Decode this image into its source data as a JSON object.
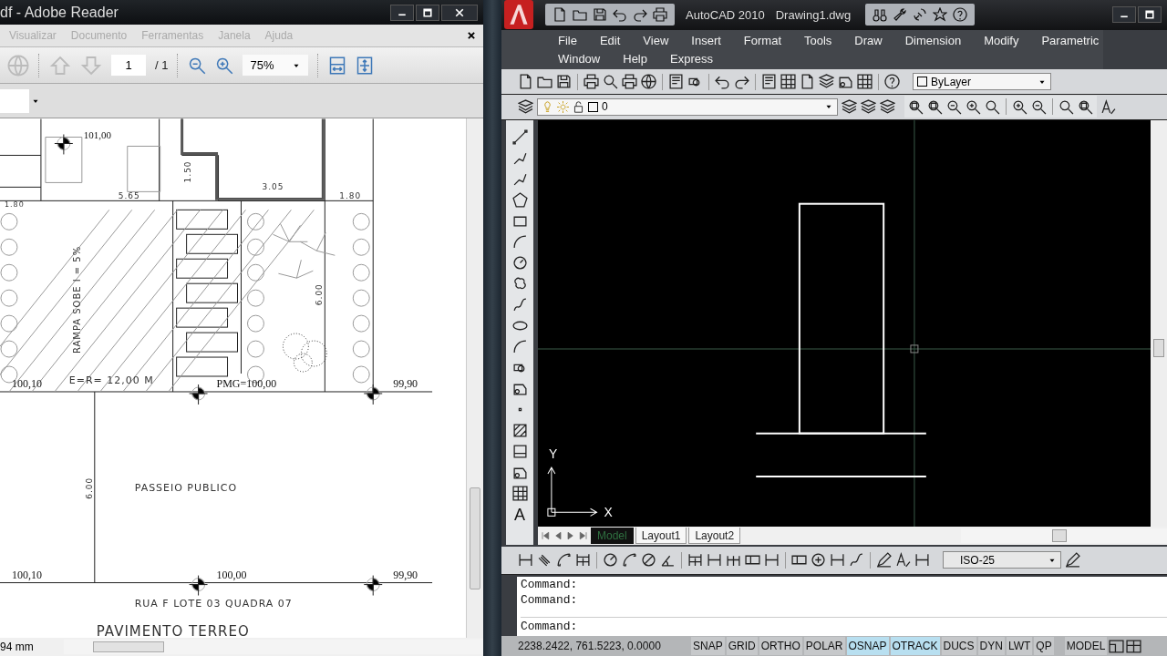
{
  "reader": {
    "title": "df - Adobe Reader",
    "menu": [
      "Visualizar",
      "Documento",
      "Ferramentas",
      "Janela",
      "Ajuda"
    ],
    "page_field": "1",
    "page_total": "/ 1",
    "zoom": "75%",
    "plan_labels": [
      "101,00",
      "1.50",
      "3.05",
      "1.80",
      "5.65",
      "1.80",
      "RAMPA SOBE I = 5%",
      "6.00",
      "100,10",
      "E=R= 12,00 M",
      "PMG=100,00",
      "99,90",
      "6.00",
      "PASSEIO PUBLICO",
      "100,10",
      "100,00",
      "99,90",
      "RUA F   LOTE 03   QUADRA 07",
      "PAVIMENTO TERREO"
    ],
    "page_size": "94 mm"
  },
  "autocad": {
    "app_name": "AutoCAD 2010",
    "file_name": "Drawing1.dwg",
    "menu": [
      "File",
      "Edit",
      "View",
      "Insert",
      "Format",
      "Tools",
      "Draw",
      "Dimension",
      "Modify",
      "Parametric",
      "Window",
      "Help",
      "Express"
    ],
    "color_control": "ByLayer",
    "layer": "0",
    "text_tool": "A",
    "axis_y": "Y",
    "axis_x": "X",
    "layout_tabs": [
      {
        "label": "Model",
        "selected": true
      },
      {
        "label": "Layout1",
        "selected": false
      },
      {
        "label": "Layout2",
        "selected": false
      }
    ],
    "dim_style": "ISO-25",
    "command_lines": [
      "Command:",
      "Command:",
      "Command:"
    ],
    "coordinates": "2238.2422, 761.5223, 0.0000",
    "status_toggles": [
      {
        "label": "SNAP",
        "on": false
      },
      {
        "label": "GRID",
        "on": false
      },
      {
        "label": "ORTHO",
        "on": false
      },
      {
        "label": "POLAR",
        "on": false
      },
      {
        "label": "OSNAP",
        "on": true
      },
      {
        "label": "OTRACK",
        "on": true
      },
      {
        "label": "DUCS",
        "on": false
      },
      {
        "label": "DYN",
        "on": false
      },
      {
        "label": "LWT",
        "on": false
      },
      {
        "label": "QP",
        "on": false
      }
    ],
    "space": "MODEL"
  }
}
